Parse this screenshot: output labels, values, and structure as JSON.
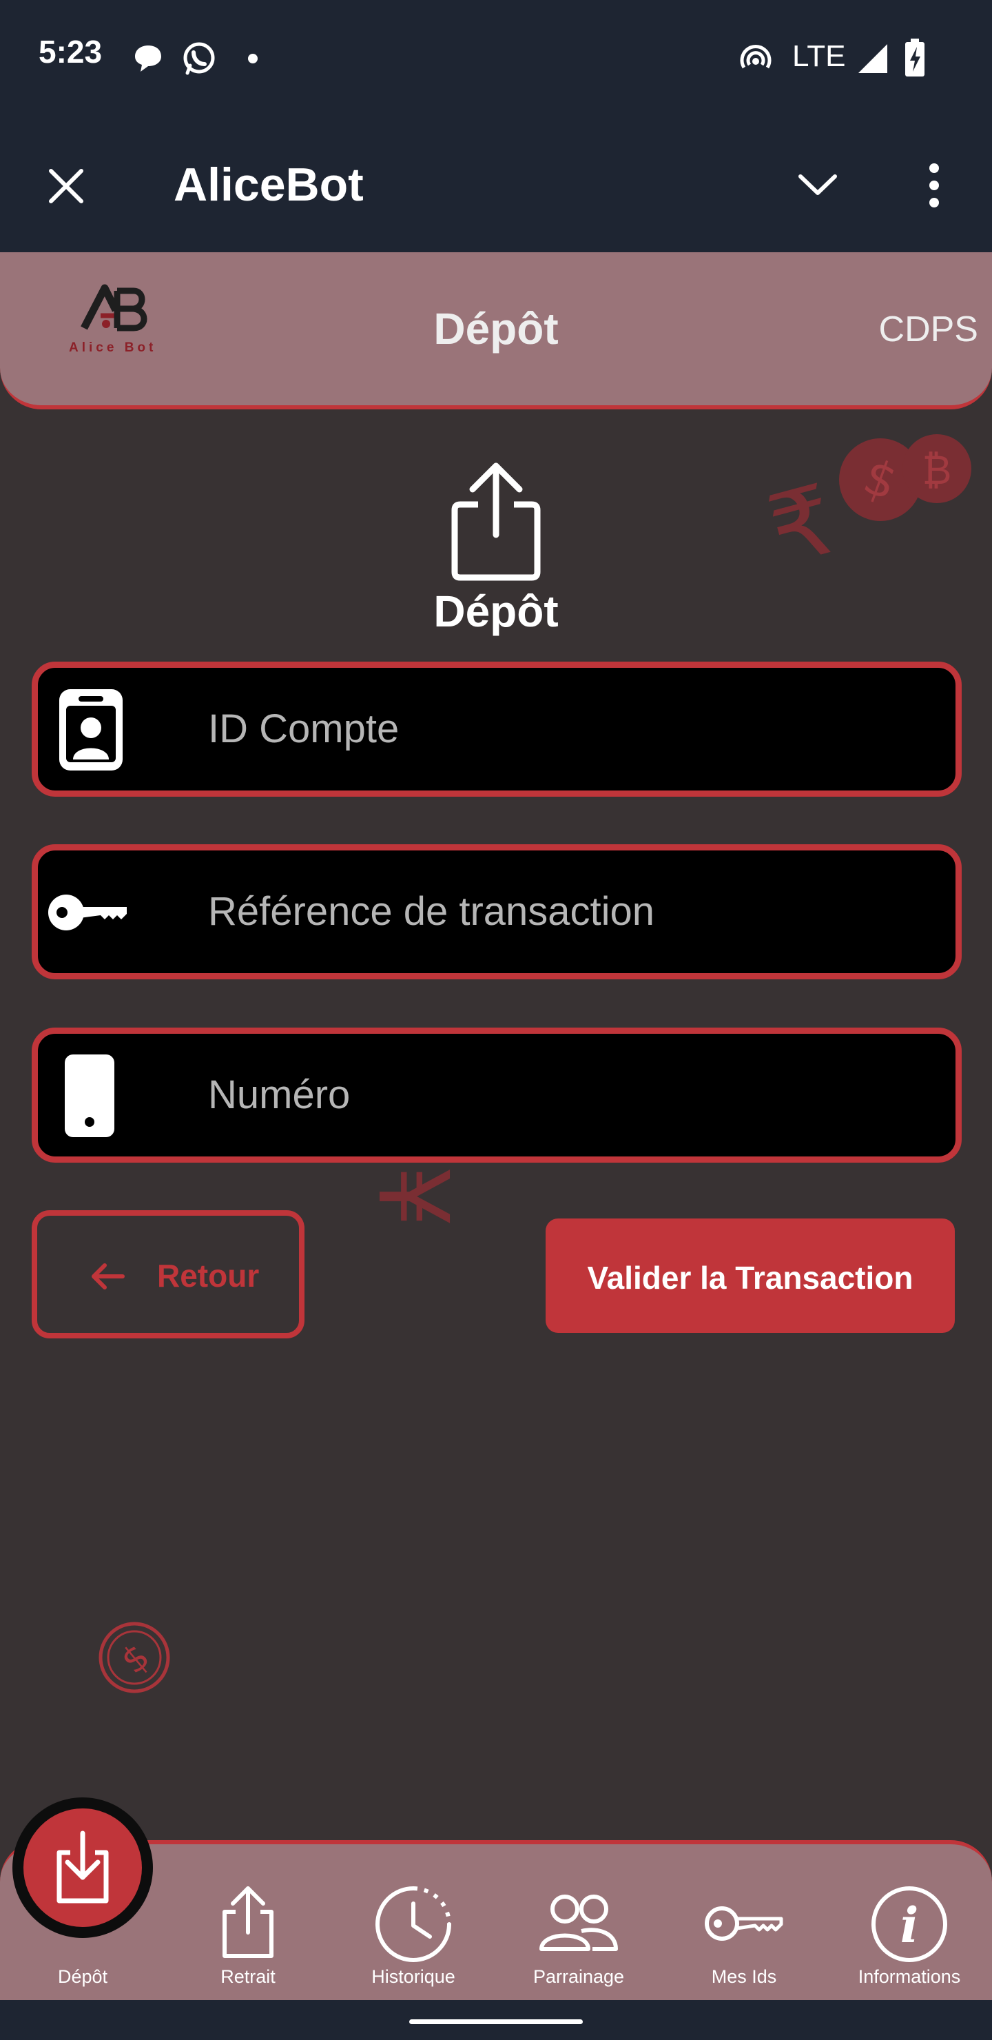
{
  "status_bar": {
    "time": "5:23",
    "network": "LTE",
    "icons": [
      "chat-bubble-icon",
      "whatsapp-icon",
      "dot-icon",
      "hotspot-icon",
      "signal-icon",
      "battery-charging-icon"
    ]
  },
  "app_bar": {
    "title": "AliceBot",
    "icons": [
      "close-icon",
      "chevron-down-icon",
      "more-vert-icon"
    ]
  },
  "header": {
    "logo_text": "Alice Bot",
    "title": "Dépôt",
    "right_text": "CDPS"
  },
  "section": {
    "title": "Dépôt",
    "icon": "share-upload-icon"
  },
  "form": {
    "fields": [
      {
        "placeholder": "ID Compte",
        "icon": "id-badge-icon"
      },
      {
        "placeholder": "Référence de transaction",
        "icon": "key-icon"
      },
      {
        "placeholder": "Numéro",
        "icon": "phone-icon"
      }
    ],
    "back_label": "Retour",
    "submit_label": "Valider la Transaction"
  },
  "bottom_nav": {
    "active": "Dépôt",
    "items": [
      {
        "label": "Dépôt",
        "icon": "download-icon"
      },
      {
        "label": "Retrait",
        "icon": "upload-icon"
      },
      {
        "label": "Historique",
        "icon": "clock-icon"
      },
      {
        "label": "Parrainage",
        "icon": "people-icon"
      },
      {
        "label": "Mes Ids",
        "icon": "key-icon"
      },
      {
        "label": "Informations",
        "icon": "info-icon"
      }
    ]
  },
  "colors": {
    "accent": "#c0353a",
    "header_bg": "#9a7479",
    "page_bg": "#383233",
    "bar_bg": "#1e2532"
  }
}
